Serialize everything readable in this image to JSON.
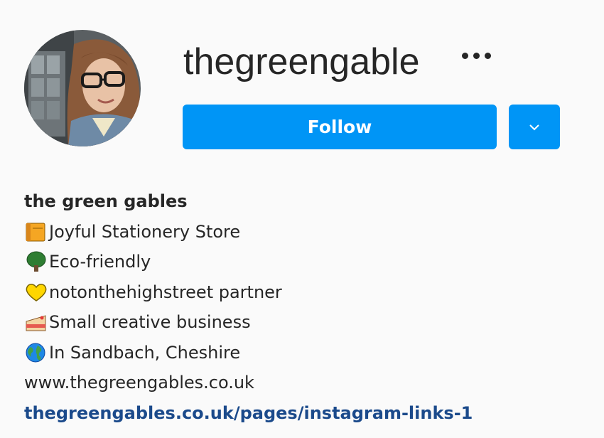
{
  "profile": {
    "username": "thegreengable",
    "full_name": "the green gables",
    "bio_lines": [
      {
        "icon": "notebook-icon",
        "text": "Joyful Stationery Store"
      },
      {
        "icon": "tree-icon",
        "text": "Eco-friendly"
      },
      {
        "icon": "yellow-heart-icon",
        "text": "notonthehighstreet partner"
      },
      {
        "icon": "cake-icon",
        "text": "Small creative business"
      },
      {
        "icon": "globe-icon",
        "text": "In Sandbach, Cheshire"
      }
    ],
    "website_text": "www.thegreengables.co.uk",
    "link_text": "thegreengables.co.uk/pages/instagram-links-1"
  },
  "actions": {
    "follow_label": "Follow",
    "more_icon": "ellipsis-icon",
    "dropdown_icon": "chevron-down-icon"
  },
  "colors": {
    "accent": "#0095f6",
    "link": "#1b4a8b",
    "text": "#262626",
    "background": "#fafafa"
  }
}
